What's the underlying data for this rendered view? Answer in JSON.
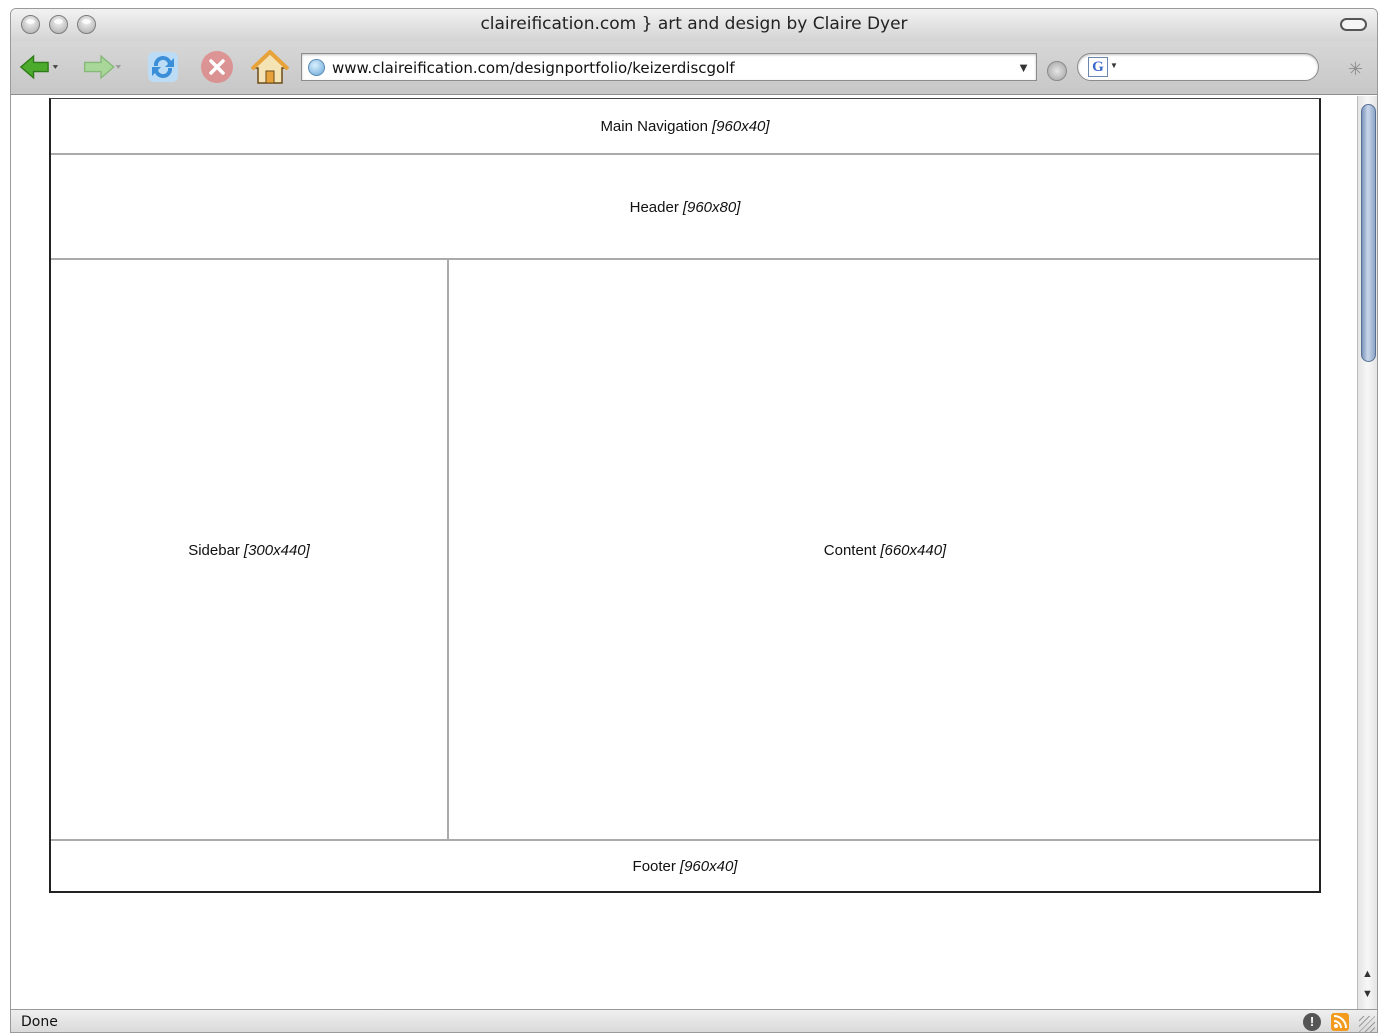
{
  "window": {
    "title": "claireification.com } art and design by Claire Dyer"
  },
  "toolbar": {
    "url": "www.claireification.com/designportfolio/keizerdiscgolf",
    "search_value": "",
    "search_engine_letter": "G",
    "icons": [
      "back-arrow-icon",
      "forward-arrow-icon",
      "reload-icon",
      "stop-icon",
      "home-icon",
      "globe-icon",
      "go-icon",
      "google-icon",
      "spinner-icon"
    ]
  },
  "wireframe": {
    "main_nav": {
      "label": "Main Navigation",
      "size": "[960x40]"
    },
    "header": {
      "label": "Header",
      "size": "[960x80]"
    },
    "sidebar": {
      "label": "Sidebar",
      "size": "[300x440]"
    },
    "content": {
      "label": "Content",
      "size": "[660x440]"
    },
    "footer": {
      "label": "Footer",
      "size": "[960x40]"
    }
  },
  "status": {
    "text": "Done",
    "icons": [
      "info-icon",
      "rss-icon",
      "resize-grip-icon"
    ]
  },
  "colors": {
    "back_arrow": "#4caa2c",
    "forward_arrow": "#a9d79a",
    "reload": "#3b8ed8",
    "stop": "#e36a6a",
    "home": "#e8a23a",
    "scroll_thumb": "#8ea6c6"
  }
}
